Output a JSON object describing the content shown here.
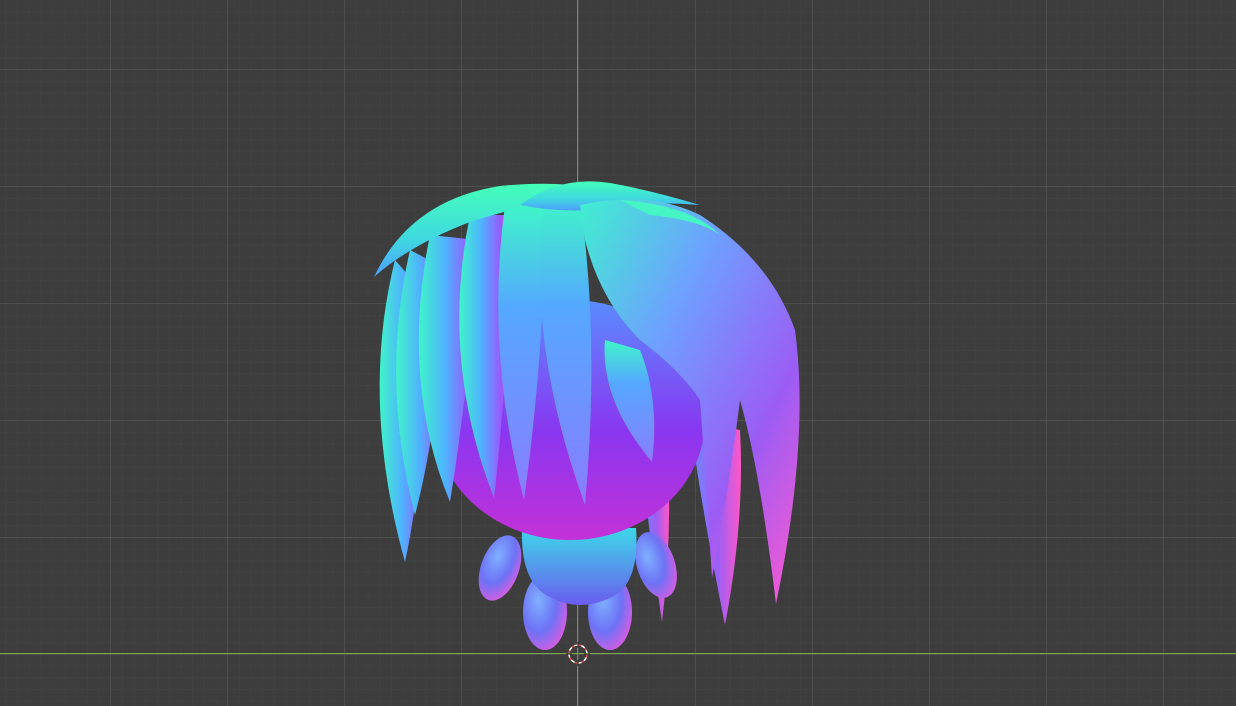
{
  "viewport": {
    "view": "front-orthographic",
    "background_color": "#3d3d3d",
    "grid_color": "#4a4a4a",
    "z_axis_color": "#5a86c8",
    "x_axis_color": "#7fa84a"
  },
  "scene": {
    "object": "hair-ball-character",
    "shading": "normal-map",
    "palette": {
      "cyan": "#3ff5c8",
      "blue": "#5a8cff",
      "violet": "#9a3cf0",
      "magenta": "#e43cd8",
      "pink": "#ff6fd0"
    }
  },
  "cursor": {
    "name": "3d-cursor",
    "colors": [
      "#d94b4b",
      "#ffffff"
    ]
  }
}
